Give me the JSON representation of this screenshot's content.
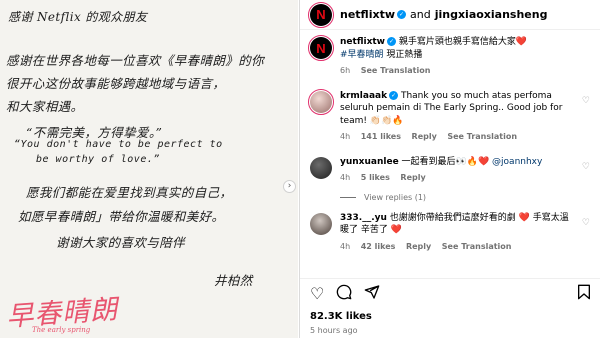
{
  "post_image": {
    "letter_lines": [
      "感谢 Netflix 的观众朋友",
      "感谢在世界各地每一位喜欢《早春晴朗》的你",
      "很开心这份故事能够跨越地域与语言，",
      "和大家相遇。",
      "“不需完美，方得挚爱。”",
      "“You don't have to be perfect to",
      "be worthy of love.”",
      "愿我们都能在爱里找到真实的自己，",
      "如愿早春晴朗」带给你温暖和美好。",
      "谢谢大家的喜欢与陪伴",
      "井柏然"
    ],
    "logo_text": "早春晴朗",
    "logo_subtext": "The early spring",
    "next_icon": "chevron-right-icon"
  },
  "header": {
    "username": "netflixtw",
    "connector": "and",
    "collaborator": "jingxiaoxiansheng"
  },
  "caption": {
    "username": "netflixtw",
    "text": "親手寫片頭也親手寫信給大家",
    "emoji": "❤️",
    "hashtag": "#早春晴朗",
    "text2": " 現正熱播",
    "time": "6h",
    "see_translation": "See Translation"
  },
  "comments": [
    {
      "username": "krmlaaak",
      "text": "Thank you so much atas perfoma seluruh pemain di The Early Spring.. Good job for team! 👏🏻👏🏻🔥",
      "time": "4h",
      "likes": "141 likes",
      "reply": "Reply",
      "see_translation": "See Translation"
    },
    {
      "username": "yunxuanlee",
      "text": "一起看到最后👀🔥❤️",
      "mention": "@joannhxy",
      "time": "4h",
      "likes": "5 likes",
      "reply": "Reply"
    },
    {
      "username": "333.__.yu",
      "text": "也謝謝你帶給我們這麼好看的劇 ❤️ 手寫太溫暖了 辛苦了 ❤️",
      "time": "4h",
      "likes": "42 likes",
      "reply": "Reply",
      "see_translation": "See Translation"
    }
  ],
  "view_replies": "View replies (1)",
  "actions": {
    "like_icon": "heart-icon",
    "comment_icon": "comment-icon",
    "share_icon": "share-icon",
    "save_icon": "bookmark-icon"
  },
  "likes_count": "82.3K likes",
  "post_time": "5 hours ago"
}
